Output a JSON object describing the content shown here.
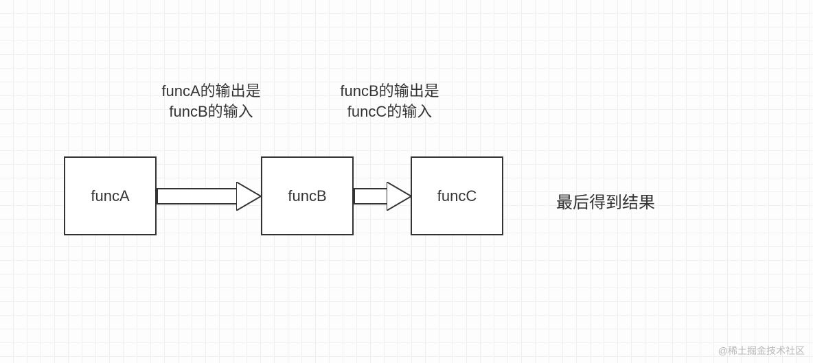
{
  "boxes": {
    "a": "funcA",
    "b": "funcB",
    "c": "funcC"
  },
  "labels": {
    "ab_line1": "funcA的输出是",
    "ab_line2": "funcB的输入",
    "bc_line1": "funcB的输出是",
    "bc_line2": "funcC的输入"
  },
  "result": "最后得到结果",
  "watermark": "@稀土掘金技术社区"
}
